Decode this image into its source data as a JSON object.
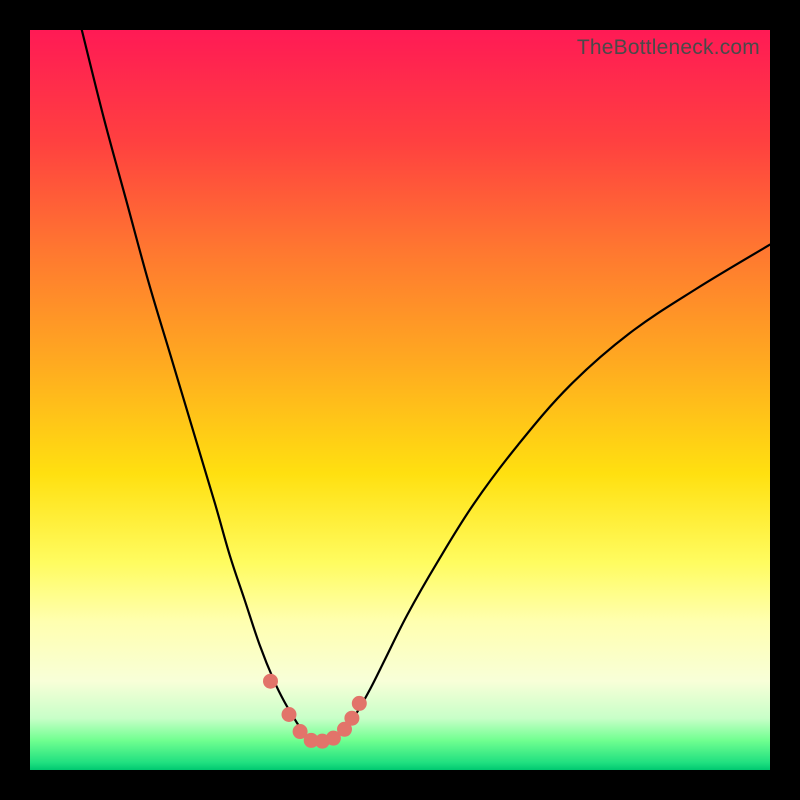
{
  "watermark": "TheBottleneck.com",
  "chart_data": {
    "type": "line",
    "title": "",
    "xlabel": "",
    "ylabel": "",
    "xlim": [
      0,
      100
    ],
    "ylim": [
      0,
      100
    ],
    "series": [
      {
        "name": "left-branch",
        "x": [
          7,
          10,
          13,
          16,
          19,
          22,
          25,
          27,
          29,
          31,
          33,
          34.5,
          36,
          37,
          38,
          38.8
        ],
        "y": [
          100,
          88,
          77,
          66,
          56,
          46,
          36,
          29,
          23,
          17,
          12,
          9,
          6.5,
          5,
          4,
          3.8
        ]
      },
      {
        "name": "right-branch",
        "x": [
          38.8,
          40,
          42,
          44,
          46,
          48,
          51,
          55,
          60,
          66,
          73,
          81,
          90,
          100
        ],
        "y": [
          3.8,
          4,
          5,
          7.5,
          11,
          15,
          21,
          28,
          36,
          44,
          52,
          59,
          65,
          71
        ]
      },
      {
        "name": "markers",
        "x": [
          32.5,
          35,
          36.5,
          38,
          39.5,
          41,
          42.5,
          43.5,
          44.5
        ],
        "y": [
          12,
          7.5,
          5.2,
          4,
          3.9,
          4.3,
          5.5,
          7,
          9
        ]
      }
    ]
  }
}
